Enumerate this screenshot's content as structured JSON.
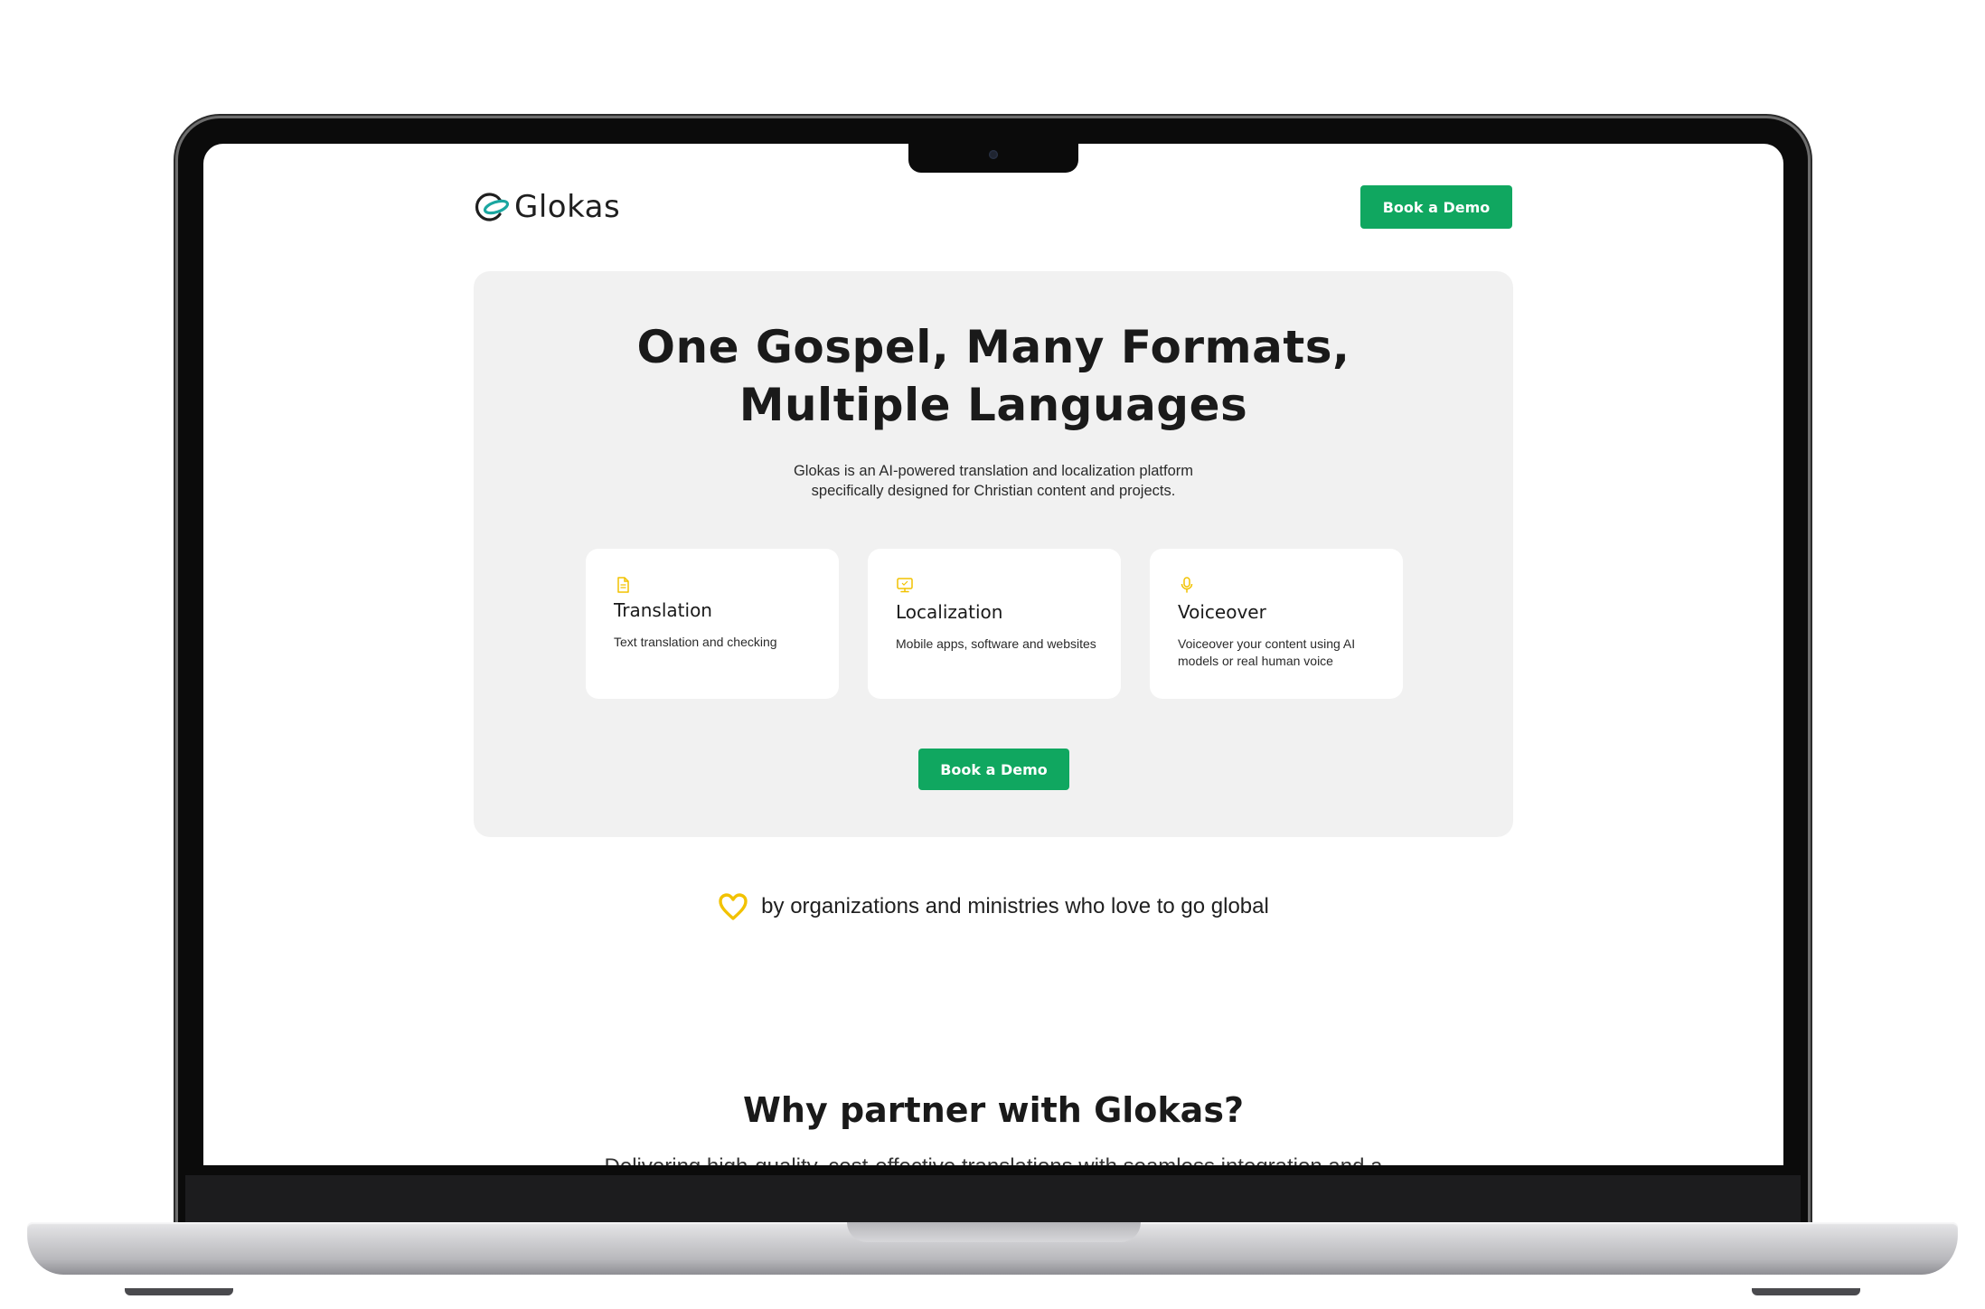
{
  "brand": {
    "name": "Glokas",
    "accent_color": "#10a760",
    "icon_color": "#f2c200",
    "logo_teal": "#1aa6a0"
  },
  "nav": {
    "cta_label": "Book a Demo"
  },
  "hero": {
    "title_line1": "One Gospel, Many Formats,",
    "title_line2": "Multiple Languages",
    "subtitle_line1": "Glokas is an AI-powered translation and localization platform",
    "subtitle_line2": "specifically designed for Christian content and projects.",
    "cta_label": "Book a Demo",
    "cards": [
      {
        "icon": "document-icon",
        "title": "Translation",
        "description": "Text translation and checking"
      },
      {
        "icon": "monitor-icon",
        "title": "Localization",
        "description": "Mobile apps,  software and websites"
      },
      {
        "icon": "microphone-icon",
        "title": "Voiceover",
        "description": "Voiceover your content using AI models or real human voice"
      }
    ]
  },
  "trust": {
    "icon": "heart-icon",
    "text": "by organizations and ministries who love to go global"
  },
  "why": {
    "heading": "Why partner with Glokas?",
    "subtitle": "Delivering high-quality, cost-effective translations with seamless integration and a"
  }
}
